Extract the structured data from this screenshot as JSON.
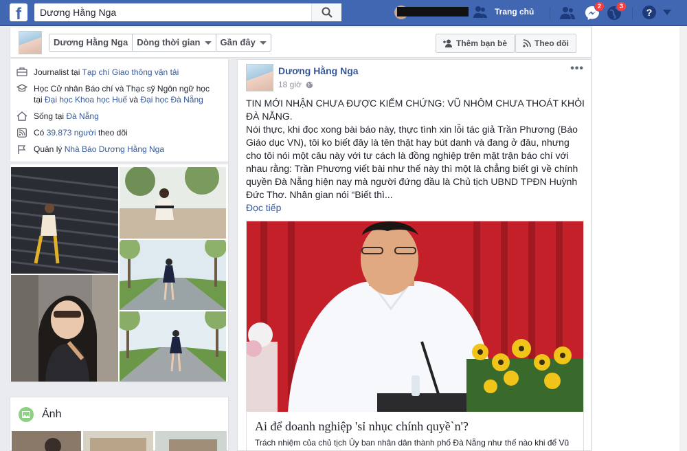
{
  "topbar": {
    "logo_letter": "f",
    "search_value": "Dương Hằng Nga",
    "home_label": "Trang chủ",
    "messages_badge": "2",
    "notifications_badge": "3",
    "color": "#4267b2"
  },
  "profile_nav": {
    "crumbs": [
      {
        "label": "Dương Hằng Nga"
      },
      {
        "label": "Dòng thời gian"
      },
      {
        "label": "Gần đây"
      }
    ],
    "add_friend_label": "Thêm bạn bè",
    "follow_label": "Theo dõi"
  },
  "intro": {
    "work": {
      "prefix": "Journalist tại ",
      "link": "Tạp chí Giao thông vận tải"
    },
    "edu": {
      "line1": "Học Cử nhân Báo chí và Thạc sỹ Ngôn ngữ học",
      "prefix": "tại ",
      "link1": "Đại học Khoa học Huế",
      "mid": " và ",
      "link2": "Đại học Đà Nẵng"
    },
    "lives": {
      "prefix": "Sống tại ",
      "link": "Đà Nẵng"
    },
    "followers": {
      "prefix": "Có ",
      "link": "39.873 người",
      "suffix": " theo dõi"
    },
    "manage": {
      "prefix": "Quản lý ",
      "link": "Nhà Báo Dương Hằng Nga"
    }
  },
  "photos_section": {
    "title": "Ảnh"
  },
  "post": {
    "author": "Dương Hằng Nga",
    "time": "18 giờ",
    "more": "•••",
    "paragraph1": "TIN MỚI NHẬN CHƯA ĐƯỢC KIỂM CHỨNG: VŨ NHÔM CHƯA THOÁT KHỎI ĐÀ NẴNG.",
    "paragraph2": "Nói thực, khi đọc xong bài báo này, thực tình xin lỗi tác giả Trần Phương (Báo Giáo dục VN), tôi ko biết đây là tên thật hay bút danh và đang ở đâu, nhưng cho tôi nói một câu này với tư cách là đồng nghiệp trên mặt trận báo chí với nhau rằng: Trần Phương viết bài như thế này thì một là chẳng biết gì về chính quyền Đà Nẵng hiện nay mà người đứng đầu là Chủ tịch UBND TPĐN Huỳnh Đức Thơ. Nhân gian nói “Biết thì...",
    "read_more": "Đọc tiếp",
    "link_title": "Ai để doanh nghiệp 'sỉ nhục chính quyề`n'?",
    "link_desc": "Trách nhiệm của chủ tịch Ủy ban nhân dân thành phố Đà Nẵng như thế nào khi để Vũ"
  }
}
